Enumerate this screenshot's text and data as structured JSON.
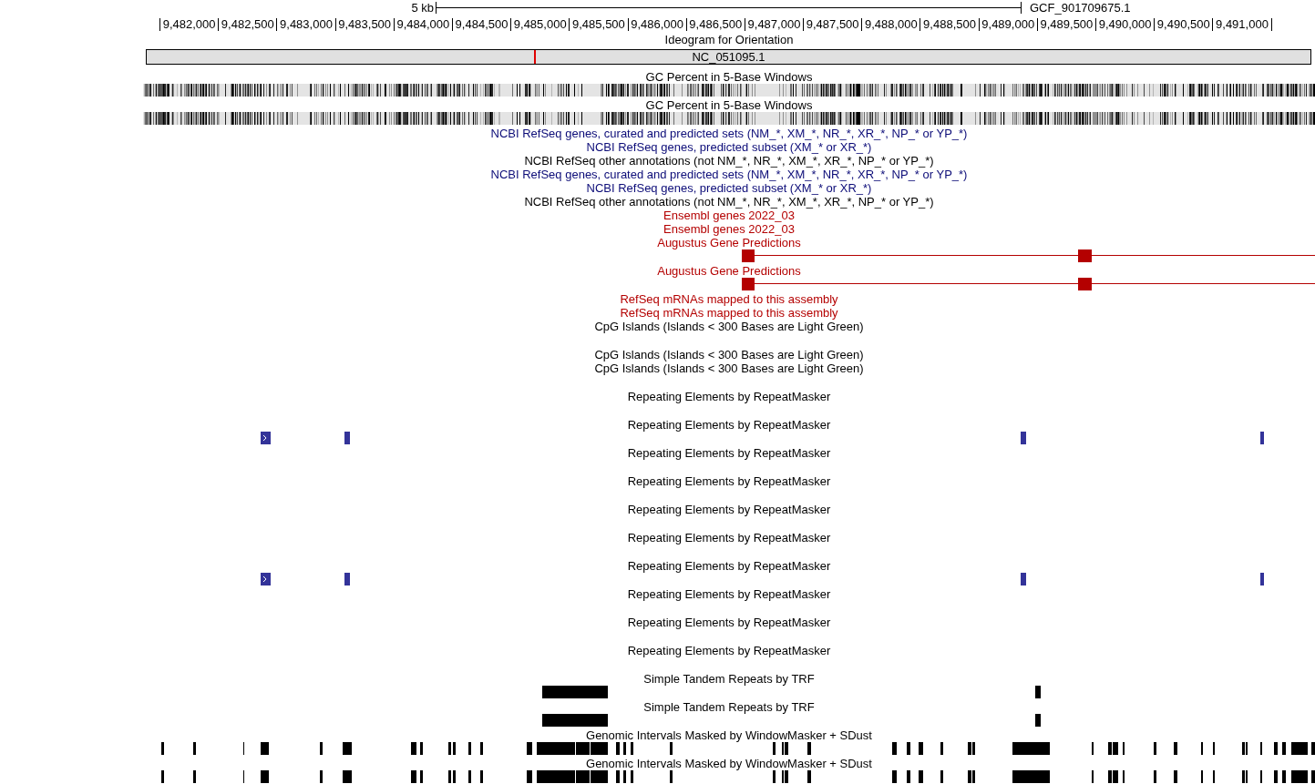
{
  "scale": {
    "label": "5 kb",
    "assembly": "GCF_901709675.1"
  },
  "ruler": {
    "ticks": [
      "9,482,000",
      "9,482,500",
      "9,483,000",
      "9,483,500",
      "9,484,000",
      "9,484,500",
      "9,485,000",
      "9,485,500",
      "9,486,000",
      "9,486,500",
      "9,487,000",
      "9,487,500",
      "9,488,000",
      "9,488,500",
      "9,489,000",
      "9,489,500",
      "9,490,000",
      "9,490,500",
      "9,491,000"
    ]
  },
  "ideogram": {
    "title": "Ideogram for Orientation",
    "chromosome": "NC_051095.1"
  },
  "tracks": [
    {
      "title": "GC Percent in 5-Base Windows",
      "color": "#000000",
      "kind": "gc"
    },
    {
      "title": "GC Percent in 5-Base Windows",
      "color": "#000000",
      "kind": "gc"
    },
    {
      "title": "NCBI RefSeq genes, curated and predicted sets (NM_*, XM_*, NR_*, XR_*, NP_* or YP_*)",
      "color": "#0c0c78",
      "kind": "label"
    },
    {
      "title": "NCBI RefSeq genes, predicted subset (XM_* or XR_*)",
      "color": "#0c0c78",
      "kind": "label"
    },
    {
      "title": "NCBI RefSeq other annotations (not NM_*, NR_*, XM_*, XR_*, NP_* or YP_*)",
      "color": "#000000",
      "kind": "label"
    },
    {
      "title": "NCBI RefSeq genes, curated and predicted sets (NM_*, XM_*, NR_*, XR_*, NP_* or YP_*)",
      "color": "#0c0c78",
      "kind": "label"
    },
    {
      "title": "NCBI RefSeq genes, predicted subset (XM_* or XR_*)",
      "color": "#0c0c78",
      "kind": "label"
    },
    {
      "title": "NCBI RefSeq other annotations (not NM_*, NR_*, XM_*, XR_*, NP_* or YP_*)",
      "color": "#000000",
      "kind": "label"
    },
    {
      "title": "Ensembl genes 2022_03",
      "color": "#b40000",
      "kind": "label"
    },
    {
      "title": "Ensembl genes 2022_03",
      "color": "#b40000",
      "kind": "label"
    },
    {
      "title": "Augustus Gene Predictions",
      "color": "#b40000",
      "kind": "gene"
    },
    {
      "title": "Augustus Gene Predictions",
      "color": "#b40000",
      "kind": "gene"
    },
    {
      "title": "RefSeq mRNAs mapped to this assembly",
      "color": "#b40000",
      "kind": "label"
    },
    {
      "title": "RefSeq mRNAs mapped to this assembly",
      "color": "#b40000",
      "kind": "label"
    },
    {
      "title": "CpG Islands (Islands < 300 Bases are Light Green)",
      "color": "#000000",
      "kind": "empty"
    },
    {
      "title": "CpG Islands (Islands < 300 Bases are Light Green)",
      "color": "#000000",
      "kind": "label"
    },
    {
      "title": "CpG Islands (Islands < 300 Bases are Light Green)",
      "color": "#000000",
      "kind": "empty"
    },
    {
      "title": "Repeating Elements by RepeatMasker",
      "color": "#000000",
      "kind": "empty"
    },
    {
      "title": "Repeating Elements by RepeatMasker",
      "color": "#000000",
      "kind": "repeats"
    },
    {
      "title": "Repeating Elements by RepeatMasker",
      "color": "#000000",
      "kind": "empty"
    },
    {
      "title": "Repeating Elements by RepeatMasker",
      "color": "#000000",
      "kind": "empty"
    },
    {
      "title": "Repeating Elements by RepeatMasker",
      "color": "#000000",
      "kind": "empty"
    },
    {
      "title": "Repeating Elements by RepeatMasker",
      "color": "#000000",
      "kind": "empty"
    },
    {
      "title": "Repeating Elements by RepeatMasker",
      "color": "#000000",
      "kind": "repeats"
    },
    {
      "title": "Repeating Elements by RepeatMasker",
      "color": "#000000",
      "kind": "empty"
    },
    {
      "title": "Repeating Elements by RepeatMasker",
      "color": "#000000",
      "kind": "empty"
    },
    {
      "title": "Repeating Elements by RepeatMasker",
      "color": "#000000",
      "kind": "empty"
    },
    {
      "title": "Simple Tandem Repeats by TRF",
      "color": "#000000",
      "kind": "trf"
    },
    {
      "title": "Simple Tandem Repeats by TRF",
      "color": "#000000",
      "kind": "trf"
    },
    {
      "title": "Genomic Intervals Masked by WindowMasker + SDust",
      "color": "#000000",
      "kind": "masked"
    },
    {
      "title": "Genomic Intervals Masked by WindowMasker + SDust",
      "color": "#000000",
      "kind": "masked"
    }
  ]
}
